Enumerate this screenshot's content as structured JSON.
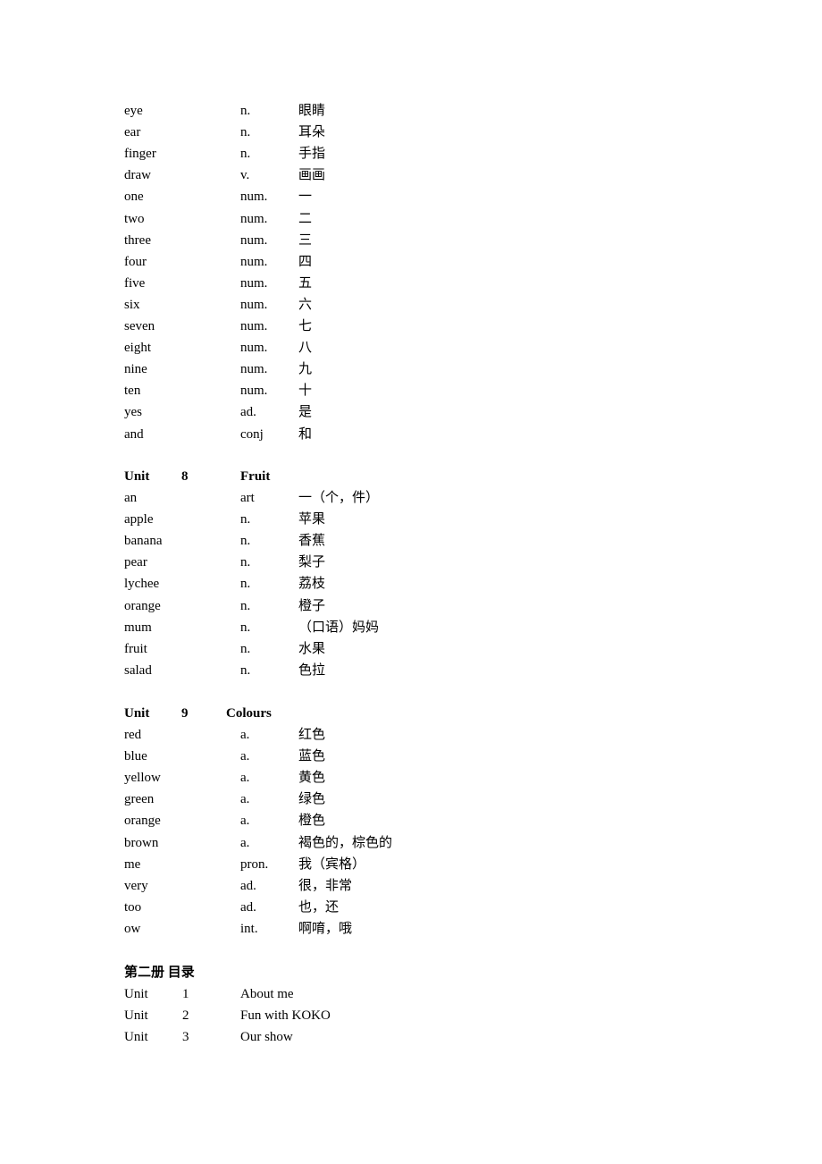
{
  "section_prev": {
    "entries": [
      {
        "word": "eye",
        "pos": "n.",
        "meaning": "眼睛"
      },
      {
        "word": "ear",
        "pos": "n.",
        "meaning": "耳朵"
      },
      {
        "word": "finger",
        "pos": "n.",
        "meaning": "手指"
      },
      {
        "word": "draw",
        "pos": "v.",
        "meaning": "画画"
      },
      {
        "word": "one",
        "pos": "num.",
        "meaning": "一"
      },
      {
        "word": "two",
        "pos": "num.",
        "meaning": "二"
      },
      {
        "word": "three",
        "pos": "num.",
        "meaning": "三"
      },
      {
        "word": "four",
        "pos": "num.",
        "meaning": "四"
      },
      {
        "word": "five",
        "pos": "num.",
        "meaning": "五"
      },
      {
        "word": "six",
        "pos": "num.",
        "meaning": "六"
      },
      {
        "word": "seven",
        "pos": "num.",
        "meaning": "七"
      },
      {
        "word": "eight",
        "pos": "num.",
        "meaning": "八"
      },
      {
        "word": "nine",
        "pos": "num.",
        "meaning": "九"
      },
      {
        "word": "ten",
        "pos": "num.",
        "meaning": "十"
      },
      {
        "word": "yes",
        "pos": "ad.",
        "meaning": "是"
      },
      {
        "word": "and",
        "pos": "conj",
        "meaning": "和"
      }
    ]
  },
  "unit8": {
    "label": "Unit",
    "number": "8",
    "title": "Fruit",
    "entries": [
      {
        "word": "an",
        "pos": "art",
        "meaning": "一（个，件）"
      },
      {
        "word": "apple",
        "pos": "n.",
        "meaning": "苹果"
      },
      {
        "word": "banana",
        "pos": "n.",
        "meaning": "香蕉"
      },
      {
        "word": "pear",
        "pos": "n.",
        "meaning": "梨子"
      },
      {
        "word": "lychee",
        "pos": "n.",
        "meaning": "荔枝"
      },
      {
        "word": "orange",
        "pos": "n.",
        "meaning": "橙子"
      },
      {
        "word": "mum",
        "pos": "n.",
        "meaning": "（口语）妈妈"
      },
      {
        "word": "fruit",
        "pos": "n.",
        "meaning": "水果"
      },
      {
        "word": "salad",
        "pos": "n.",
        "meaning": "色拉"
      }
    ]
  },
  "unit9": {
    "label": "Unit",
    "number": "9",
    "title": "Colours",
    "entries": [
      {
        "word": "red",
        "pos": "a.",
        "meaning": "红色"
      },
      {
        "word": "blue",
        "pos": "a.",
        "meaning": "蓝色"
      },
      {
        "word": "yellow",
        "pos": "a.",
        "meaning": "黄色"
      },
      {
        "word": "green",
        "pos": "a.",
        "meaning": "绿色"
      },
      {
        "word": "orange",
        "pos": "a.",
        "meaning": "橙色"
      },
      {
        "word": "brown",
        "pos": "a.",
        "meaning": "褐色的，棕色的"
      },
      {
        "word": "me",
        "pos": "pron.",
        "meaning": "我（宾格）"
      },
      {
        "word": "very",
        "pos": "ad.",
        "meaning": "很，非常"
      },
      {
        "word": "too",
        "pos": "ad.",
        "meaning": "也，还"
      },
      {
        "word": "ow",
        "pos": "int.",
        "meaning": "啊唷，哦"
      }
    ]
  },
  "toc": {
    "title": "第二册 目录",
    "items": [
      {
        "label": "Unit",
        "number": "1",
        "title": "About me"
      },
      {
        "label": "Unit",
        "number": "2",
        "title": "Fun with KOKO"
      },
      {
        "label": "Unit",
        "number": "3",
        "title": "Our show"
      }
    ]
  }
}
